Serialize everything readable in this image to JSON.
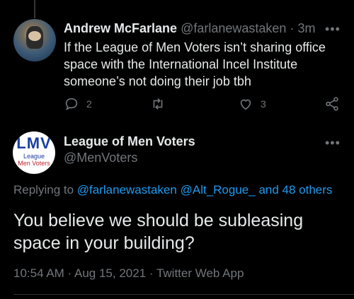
{
  "reply_tweet": {
    "author_name": "Andrew McFarlane",
    "author_handle": "@farlanewastaken",
    "separator": "·",
    "time": "3m",
    "text": "If the League of Men Voters isn’t sharing office space with the International Incel Institute someone’s not doing their job tbh",
    "reply_count": "2",
    "retweet_count": "",
    "like_count": "3",
    "icons": [
      "reply-icon",
      "retweet-icon",
      "like-icon",
      "share-icon",
      "more-icon"
    ]
  },
  "main_tweet": {
    "author_name": "League of Men Voters",
    "author_handle": "@MenVoters",
    "avatar_text": {
      "logo": "LMV",
      "line1": "League",
      "line2": "Men Voters"
    },
    "replying_prefix": "Replying to",
    "replying_mentions": [
      "@farlanewastaken",
      "@Alt_Rogue_"
    ],
    "replying_suffix": "and 48 others",
    "text": "You believe we should be subleasing space in your building?",
    "timestamp": "10:54 AM · Aug 15, 2021 · Twitter Web App"
  },
  "colors": {
    "background": "#000000",
    "text": "#e7e9ea",
    "muted": "#71767b",
    "link": "#1d9bf0"
  }
}
